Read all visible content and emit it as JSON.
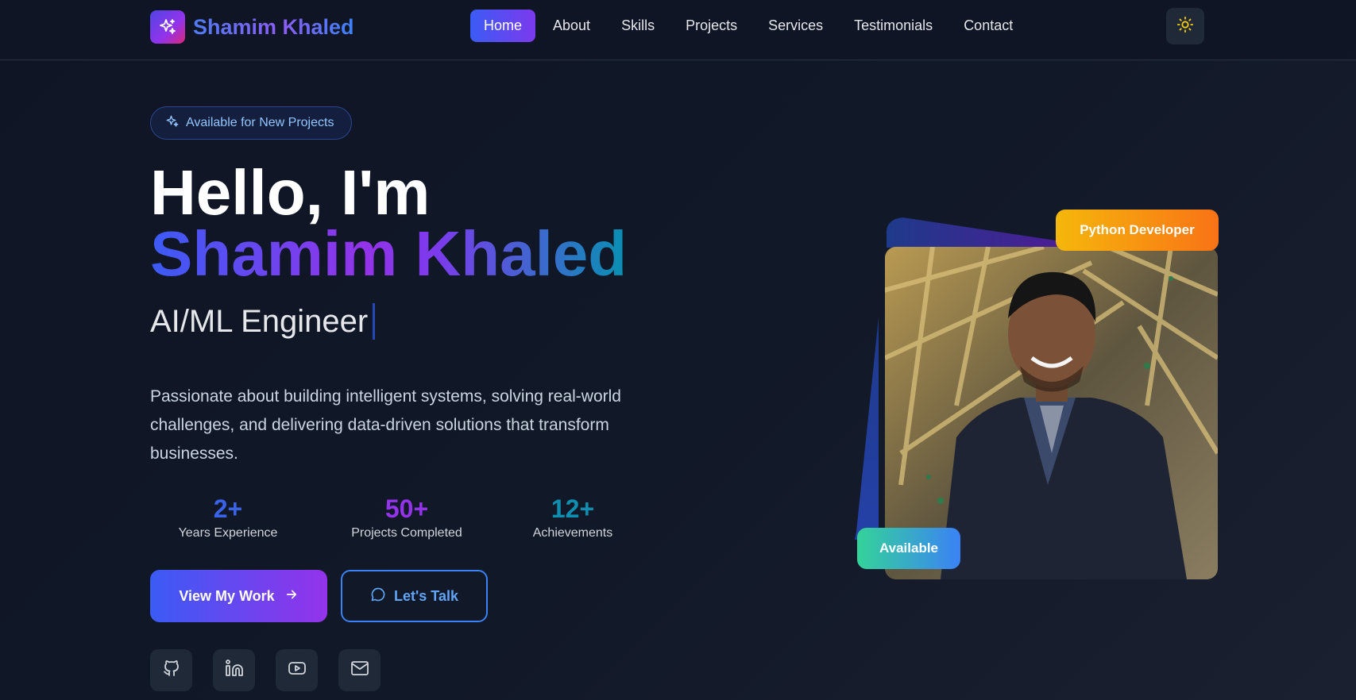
{
  "brand": {
    "name": "Shamim Khaled",
    "logo_icon": "sparkles-icon"
  },
  "nav": {
    "items": [
      {
        "label": "Home",
        "active": true
      },
      {
        "label": "About",
        "active": false
      },
      {
        "label": "Skills",
        "active": false
      },
      {
        "label": "Projects",
        "active": false
      },
      {
        "label": "Services",
        "active": false
      },
      {
        "label": "Testimonials",
        "active": false
      },
      {
        "label": "Contact",
        "active": false
      }
    ],
    "theme_toggle_icon": "sun-icon"
  },
  "hero": {
    "badge": "Available for New Projects",
    "greeting": "Hello, I'm",
    "name": "Shamim Khaled",
    "role": "AI/ML Engineer",
    "description": "Passionate about building intelligent systems, solving real-world challenges, and delivering data-driven solutions that transform businesses.",
    "stats": [
      {
        "value": "2+",
        "label": "Years Experience",
        "color": "#3b63e8"
      },
      {
        "value": "50+",
        "label": "Projects Completed",
        "color": "#9333ea"
      },
      {
        "value": "12+",
        "label": "Achievements",
        "color": "#0e8fb0"
      }
    ],
    "primary_button": "View My Work",
    "secondary_button": "Let's Talk",
    "socials": [
      "github-icon",
      "linkedin-icon",
      "youtube-icon",
      "mail-icon"
    ]
  },
  "profile": {
    "tag_top": "Python Developer",
    "tag_bottom": "Available"
  },
  "colors": {
    "accent_blue": "#3b5bf5",
    "accent_purple": "#9333ea",
    "accent_cyan": "#0891b2",
    "background": "#111827"
  }
}
